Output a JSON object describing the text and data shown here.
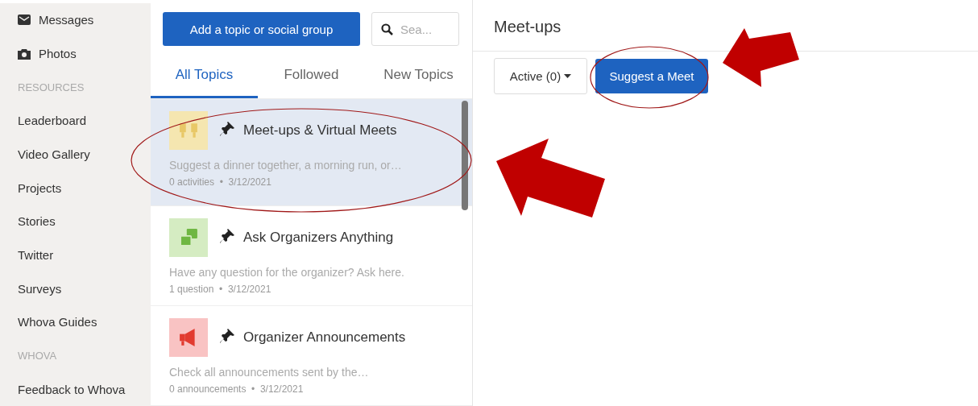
{
  "sidebar": {
    "items": [
      {
        "kind": "envelope",
        "label": "Messages"
      },
      {
        "kind": "camera",
        "label": "Photos"
      },
      {
        "kind": "header",
        "label": "RESOURCES"
      },
      {
        "kind": "item",
        "label": "Leaderboard"
      },
      {
        "kind": "item",
        "label": "Video Gallery"
      },
      {
        "kind": "item",
        "label": "Projects"
      },
      {
        "kind": "item",
        "label": "Stories"
      },
      {
        "kind": "item",
        "label": "Twitter"
      },
      {
        "kind": "item",
        "label": "Surveys"
      },
      {
        "kind": "item",
        "label": "Whova Guides"
      },
      {
        "kind": "header",
        "label": "WHOVA"
      },
      {
        "kind": "item",
        "label": "Feedback to Whova"
      }
    ]
  },
  "topics_pane": {
    "add_button": "Add a topic or social group",
    "search": {
      "placeholder": "Sea..."
    },
    "tabs": [
      {
        "label": "All Topics",
        "selected": true
      },
      {
        "label": "Followed",
        "selected": false
      },
      {
        "label": "New Topics",
        "selected": false
      }
    ],
    "topics": [
      {
        "title": "Meet-ups & Virtual Meets",
        "description": "Suggest a dinner together, a morning run, or…",
        "meta": "0 activities  •  3/12/2021",
        "kind": "cheers",
        "color": "#f5e6b0",
        "pinned": true,
        "selected": true
      },
      {
        "title": "Ask Organizers Anything",
        "description": "Have any question for the organizer? Ask here.",
        "meta": "1 question  •  3/12/2021",
        "kind": "qa",
        "color": "#d5ecc2",
        "pinned": true,
        "selected": false
      },
      {
        "title": "Organizer Announcements",
        "description": "Check all announcements sent by the…",
        "meta": "0 announcements  •  3/12/2021",
        "kind": "megaphone",
        "color": "#f9c3c3",
        "pinned": true,
        "selected": false
      }
    ]
  },
  "main": {
    "title": "Meet-ups",
    "filter": "Active (0)",
    "action_button": "Suggest a Meet"
  }
}
